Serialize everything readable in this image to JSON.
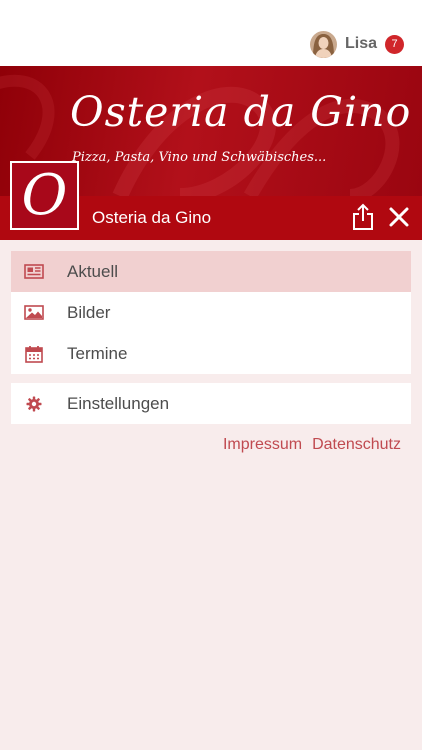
{
  "user": {
    "name": "Lisa",
    "notification_count": "7"
  },
  "banner": {
    "title": "Osteria da Gino",
    "subtitle": "Pizza, Pasta, Vino und Schwäbisches..."
  },
  "logo": {
    "letter": "O"
  },
  "header": {
    "title": "Osteria da Gino",
    "icons": [
      "share-icon",
      "close-icon"
    ]
  },
  "menu": {
    "items": [
      {
        "label": "Aktuell",
        "icon": "newspaper-icon",
        "active": true
      },
      {
        "label": "Bilder",
        "icon": "image-icon",
        "active": false
      },
      {
        "label": "Termine",
        "icon": "calendar-icon",
        "active": false
      }
    ],
    "settings": {
      "label": "Einstellungen",
      "icon": "gear-icon"
    }
  },
  "footer": {
    "impressum": "Impressum",
    "datenschutz": "Datenschutz"
  },
  "colors": {
    "brand": "#b00810",
    "accent": "#c04a50",
    "background": "#f8ecec",
    "active_item": "#f1d0d0"
  }
}
